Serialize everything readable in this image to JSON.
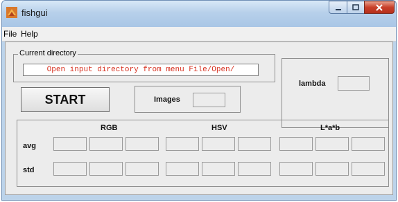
{
  "window": {
    "title": "fishgui",
    "controls": [
      "minimize-icon",
      "maximize-icon",
      "close-icon"
    ]
  },
  "menu": [
    {
      "label": "File"
    },
    {
      "label": "Help"
    }
  ],
  "directory": {
    "group_label": "Current directory",
    "value": "Open input directory from menu File/Open/"
  },
  "start_button": {
    "label": "START"
  },
  "images": {
    "label": "Images",
    "value": ""
  },
  "lambda": {
    "label": "lambda",
    "value": ""
  },
  "stats": {
    "columns": [
      "RGB",
      "HSV",
      "L*a*b"
    ],
    "rows": [
      {
        "label": "avg",
        "values": [
          "",
          "",
          "",
          "",
          "",
          "",
          "",
          "",
          ""
        ]
      },
      {
        "label": "std",
        "values": [
          "",
          "",
          "",
          "",
          "",
          "",
          "",
          "",
          ""
        ]
      }
    ]
  },
  "colors": {
    "directory_text": "#d7301f",
    "titlebar": "#b7d0ea",
    "panel": "#ececec"
  }
}
